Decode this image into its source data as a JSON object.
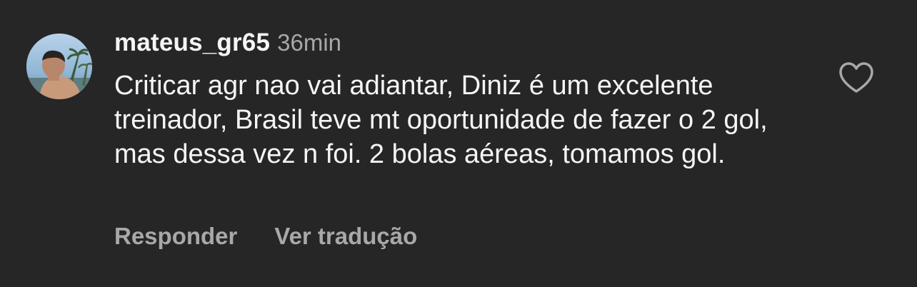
{
  "comment": {
    "username": "mateus_gr65",
    "timestamp": "36min",
    "text": "Criticar agr nao vai adiantar, Diniz é um excelente treinador, Brasil teve mt oportunidade de fazer o 2 gol, mas dessa vez n foi. 2 bolas aéreas, tomamos gol.",
    "reply_label": "Responder",
    "translate_label": "Ver tradução",
    "like_icon": "heart-outline-icon"
  },
  "colors": {
    "background": "#262626",
    "primary_text": "#f5f5f5",
    "secondary_text": "#a8a8a8"
  }
}
